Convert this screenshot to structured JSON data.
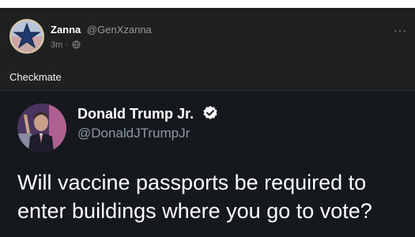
{
  "post": {
    "author": {
      "display_name": "Zanna",
      "handle": "@GenXzanna"
    },
    "meta": {
      "time": "3m ·",
      "visibility_icon": "globe-icon"
    },
    "text": "Checkmate",
    "more_icon": "more-icon",
    "more_label": "···"
  },
  "quoted_tweet": {
    "author": {
      "display_name": "Donald Trump Jr.",
      "handle": "@DonaldJTrumpJr",
      "verified_icon": "verified-badge-icon"
    },
    "text": "Will vaccine passports be required to enter buildings where you go to vote?"
  },
  "colors": {
    "background": "#1f2022",
    "quoted_background": "#15181c",
    "verified_blue": "#1d9bf0",
    "muted_text": "#8b98a5"
  }
}
